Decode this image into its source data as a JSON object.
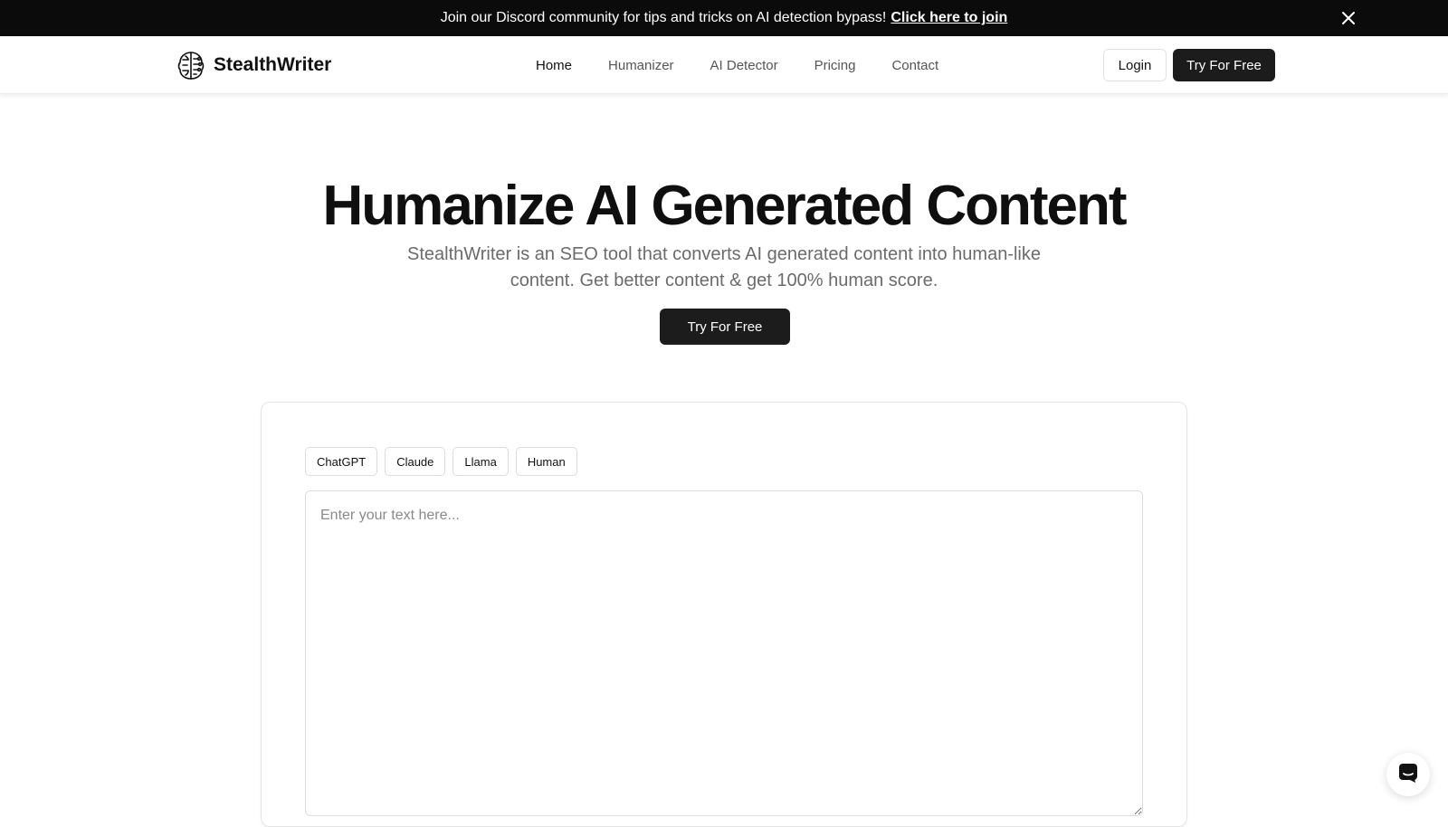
{
  "banner": {
    "text": "Join our Discord community for tips and tricks on AI detection bypass!",
    "link_label": "Click here to join",
    "close_icon": "close-icon"
  },
  "nav": {
    "brand": "StealthWriter",
    "logo_icon": "brain-icon",
    "links": [
      "Home",
      "Humanizer",
      "AI Detector",
      "Pricing",
      "Contact"
    ],
    "active_link": "Home",
    "login_label": "Login",
    "try_label": "Try For Free"
  },
  "hero": {
    "title": "Humanize AI Generated Content",
    "subtitle": "StealthWriter is an SEO tool that converts AI generated content into human-like content. Get better content & get 100% human score.",
    "cta_label": "Try For Free"
  },
  "editor": {
    "models": [
      "ChatGPT",
      "Claude",
      "Llama",
      "Human"
    ],
    "input_value": "",
    "input_placeholder": "Enter your text here..."
  },
  "chat_widget": {
    "icon": "chat-icon"
  },
  "colors": {
    "banner_bg": "#0b0b0b",
    "primary_button": "#1c1c1c",
    "text_muted": "#6b6b6b",
    "border": "#e4e4e4"
  }
}
